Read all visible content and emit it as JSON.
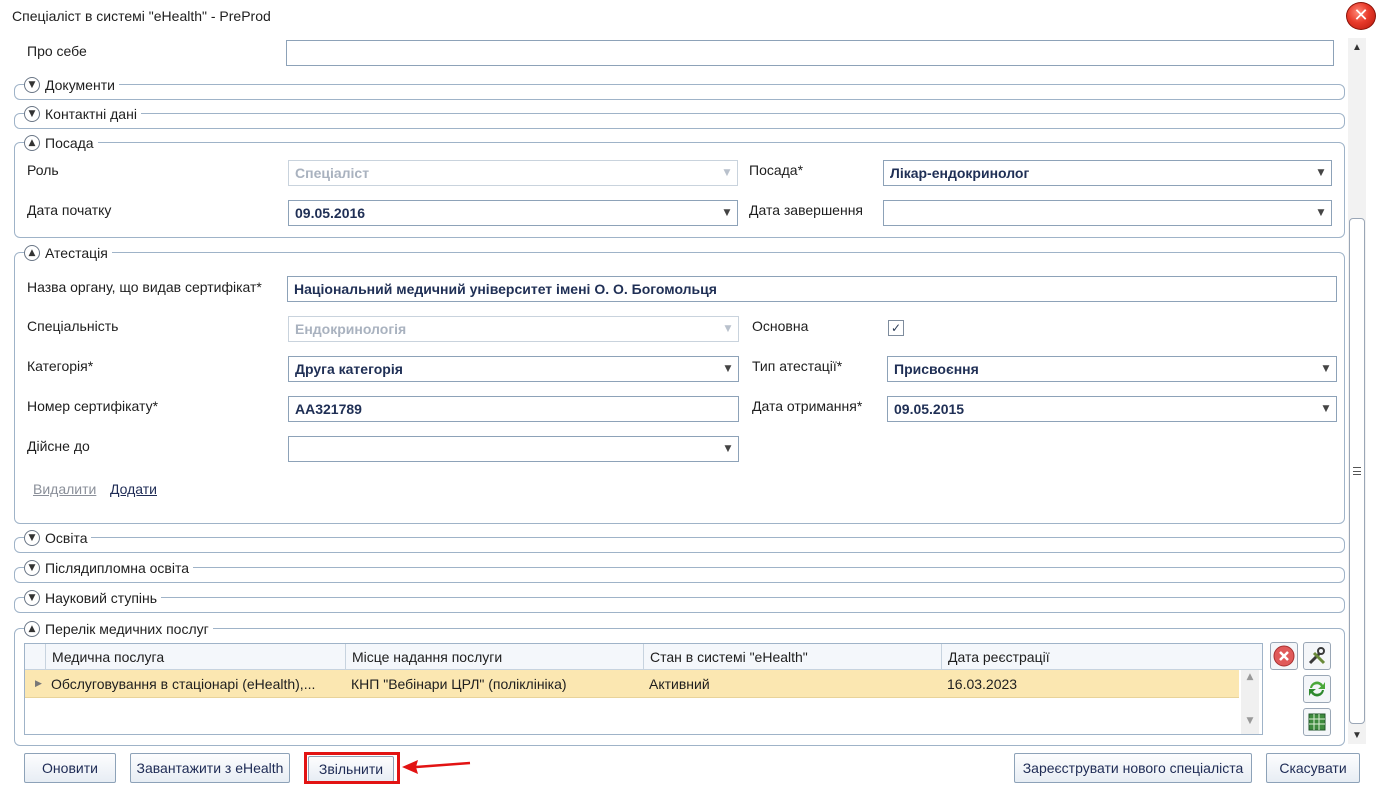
{
  "window": {
    "title": "Спеціаліст в системі \"eHealth\" - PreProd"
  },
  "about": {
    "label": "Про себе",
    "value": ""
  },
  "groups": {
    "documents": "Документи",
    "contacts": "Контактні дані",
    "position": "Посада",
    "attestation": "Атестація",
    "education": "Освіта",
    "postgrad": "Післядипломна освіта",
    "degree": "Науковий ступінь",
    "services": "Перелік медичних послуг"
  },
  "position": {
    "role_label": "Роль",
    "role_value": "Спеціаліст",
    "post_label": "Посада*",
    "post_value": "Лікар-ендокринолог",
    "start_label": "Дата початку",
    "start_value": "09.05.2016",
    "end_label": "Дата завершення",
    "end_value": ""
  },
  "attestation": {
    "org_label": "Назва органу, що видав сертифікат*",
    "org_value": "Національний медичний університет імені О. О. Богомольця",
    "spec_label": "Спеціальність",
    "spec_value": "Ендокринологія",
    "main_label": "Основна",
    "main_checked": true,
    "cat_label": "Категорія*",
    "cat_value": "Друга категорія",
    "type_label": "Тип атестації*",
    "type_value": "Присвоєння",
    "cert_label": "Номер сертифікату*",
    "cert_value": "АА321789",
    "recv_label": "Дата отримання*",
    "recv_value": "09.05.2015",
    "valid_label": "Дійсне до",
    "valid_value": "",
    "delete_link": "Видалити",
    "add_link": "Додати"
  },
  "services_table": {
    "columns": [
      "Медична послуга",
      "Місце надання послуги",
      "Стан в системі \"eHealth\"",
      "Дата реєстрації"
    ],
    "rows": [
      [
        "Обслуговування в стаціонарі (eHealth),...",
        "КНП \"Вебінари ЦРЛ\" (поліклініка)",
        "Активний",
        "16.03.2023"
      ]
    ]
  },
  "buttons": {
    "refresh": "Оновити",
    "load": "Завантажити з eHealth",
    "dismiss": "Звільнити",
    "register": "Зареєструвати нового спеціаліста",
    "cancel": "Скасувати"
  },
  "colors": {
    "selected_row": "#fbe7b1",
    "highlight": "#e21313",
    "border": "#9fb3c8"
  }
}
